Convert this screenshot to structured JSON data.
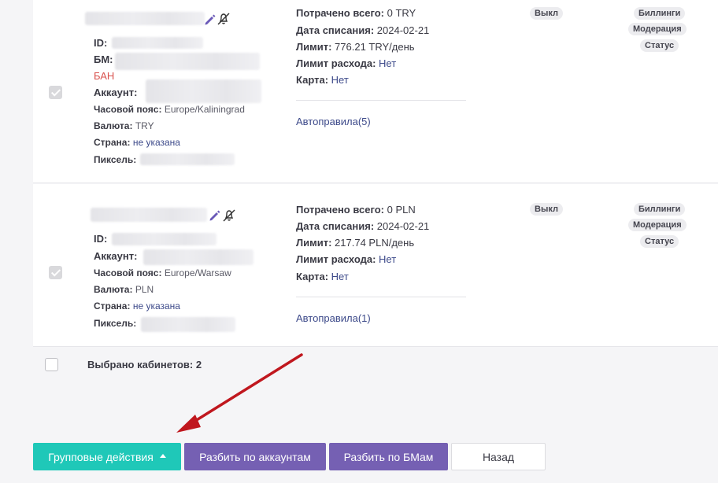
{
  "accounts": [
    {
      "id_label": "ID:",
      "bm_label": "БМ:",
      "ban_text": "БАН",
      "account_label": "Аккаунт:",
      "timezone_label": "Часовой пояс:",
      "timezone_value": "Europe/Kaliningrad",
      "currency_label": "Валюта:",
      "currency_value": "TRY",
      "country_label": "Страна:",
      "country_value": "не указана",
      "pixel_label": "Пиксель:",
      "spent_label": "Потрачено всего:",
      "spent_value": "0 TRY",
      "charge_date_label": "Дата списания:",
      "charge_date_value": "2024-02-21",
      "limit_label": "Лимит:",
      "limit_value": "776.21 TRY/день",
      "spend_limit_label": "Лимит расхода:",
      "spend_limit_value": "Нет",
      "card_label": "Карта:",
      "card_value": "Нет",
      "rules_link": "Автоправила(5)",
      "status_badge": "Выкл",
      "tags": [
        "Биллинги",
        "Модерация",
        "Статус"
      ]
    },
    {
      "id_label": "ID:",
      "account_label": "Аккаунт:",
      "timezone_label": "Часовой пояс:",
      "timezone_value": "Europe/Warsaw",
      "currency_label": "Валюта:",
      "currency_value": "PLN",
      "country_label": "Страна:",
      "country_value": "не указана",
      "pixel_label": "Пиксель:",
      "spent_label": "Потрачено всего:",
      "spent_value": "0 PLN",
      "charge_date_label": "Дата списания:",
      "charge_date_value": "2024-02-21",
      "limit_label": "Лимит:",
      "limit_value": "217.74 PLN/день",
      "spend_limit_label": "Лимит расхода:",
      "spend_limit_value": "Нет",
      "card_label": "Карта:",
      "card_value": "Нет",
      "rules_link": "Автоправила(1)",
      "status_badge": "Выкл",
      "tags": [
        "Биллинги",
        "Модерация",
        "Статус"
      ]
    }
  ],
  "footer": {
    "selected_text": "Выбрано кабинетов: 2"
  },
  "buttons": {
    "group_actions": "Групповые действия",
    "split_accounts": "Разбить по аккаунтам",
    "split_bms": "Разбить по БМам",
    "back": "Назад"
  },
  "colors": {
    "teal": "#1fc8b8",
    "purple": "#7560b3",
    "link": "#3d4a8a",
    "ban": "#d9534f",
    "arrow": "#c0171e"
  },
  "icons": [
    "pencil-icon",
    "bell-off-icon",
    "checkbox-checked",
    "arrow-annotation",
    "caret-up-icon"
  ]
}
